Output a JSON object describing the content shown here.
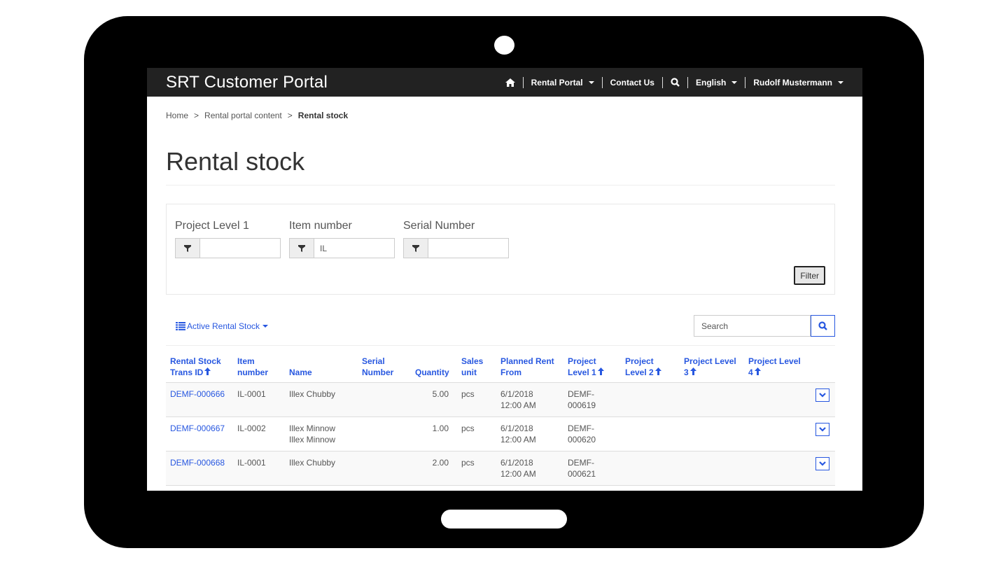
{
  "navbar": {
    "brand": "SRT Customer Portal",
    "links": [
      {
        "label": "Rental Portal",
        "dropdown": true
      },
      {
        "label": "Contact Us",
        "dropdown": false
      },
      {
        "label": "English",
        "dropdown": true
      },
      {
        "label": "Rudolf Mustermann",
        "dropdown": true
      }
    ]
  },
  "breadcrumb": [
    {
      "label": "Home"
    },
    {
      "label": "Rental portal content"
    },
    {
      "label": "Rental stock"
    }
  ],
  "breadcrumb_sep": ">",
  "page_title": "Rental stock",
  "filters": {
    "fields": [
      {
        "label": "Project Level 1",
        "value": ""
      },
      {
        "label": "Item number",
        "value": "IL"
      },
      {
        "label": "Serial Number",
        "value": ""
      }
    ],
    "button_label": "Filter"
  },
  "grid": {
    "view_label": "Active Rental Stock",
    "search_placeholder": "Search",
    "columns": [
      {
        "line1": "Rental Stock",
        "line2": "Trans ID",
        "sort": "asc"
      },
      {
        "line1": "Item",
        "line2": "number",
        "sort": null
      },
      {
        "line1": "",
        "line2": "Name",
        "sort": null
      },
      {
        "line1": "Serial",
        "line2": "Number",
        "sort": null
      },
      {
        "line1": "",
        "line2": "Quantity",
        "sort": null
      },
      {
        "line1": "Sales",
        "line2": "unit",
        "sort": null
      },
      {
        "line1": "Planned Rent",
        "line2": "From",
        "sort": null
      },
      {
        "line1": "Project",
        "line2": "Level 1",
        "sort": "asc"
      },
      {
        "line1": "Project",
        "line2": "Level 2",
        "sort": "asc"
      },
      {
        "line1": "Project Level",
        "line2": "3",
        "sort": "asc"
      },
      {
        "line1": "Project Level",
        "line2": "4",
        "sort": "asc"
      }
    ],
    "rows": [
      {
        "trans_id": "DEMF-000666",
        "item_number": "IL-0001",
        "name_1": "Illex Chubby",
        "name_2": "",
        "serial": "",
        "quantity": "5.00",
        "unit": "pcs",
        "rent_date": "6/1/2018",
        "rent_time": "12:00 AM",
        "pl1_a": "DEMF-",
        "pl1_b": "000619",
        "pl2": "",
        "pl3": "",
        "pl4": ""
      },
      {
        "trans_id": "DEMF-000667",
        "item_number": "IL-0002",
        "name_1": "Illex Minnow",
        "name_2": "Illex Minnow",
        "serial": "",
        "quantity": "1.00",
        "unit": "pcs",
        "rent_date": "6/1/2018",
        "rent_time": "12:00 AM",
        "pl1_a": "DEMF-",
        "pl1_b": "000620",
        "pl2": "",
        "pl3": "",
        "pl4": ""
      },
      {
        "trans_id": "DEMF-000668",
        "item_number": "IL-0001",
        "name_1": "Illex Chubby",
        "name_2": "",
        "serial": "",
        "quantity": "2.00",
        "unit": "pcs",
        "rent_date": "6/1/2018",
        "rent_time": "12:00 AM",
        "pl1_a": "DEMF-",
        "pl1_b": "000621",
        "pl2": "",
        "pl3": "",
        "pl4": ""
      }
    ]
  },
  "colors": {
    "navbar_bg": "#222222",
    "accent": "#2757e0",
    "device_frame": "#000000"
  }
}
